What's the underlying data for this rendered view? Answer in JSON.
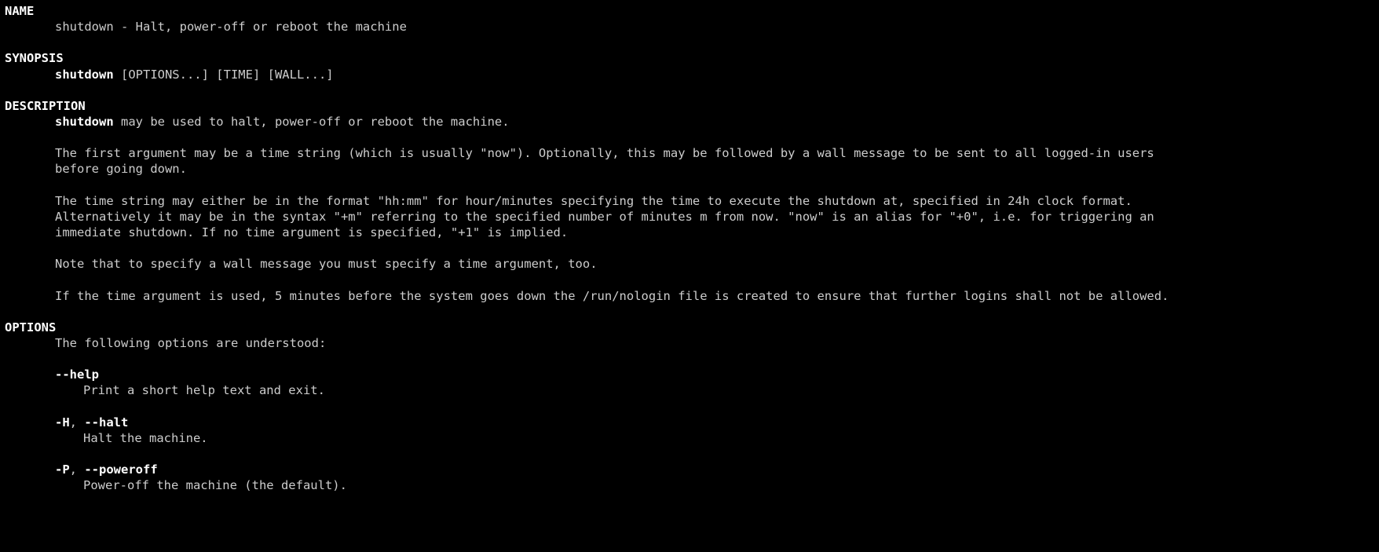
{
  "sections": {
    "name": {
      "header": "NAME",
      "line": "shutdown - Halt, power-off or reboot the machine"
    },
    "synopsis": {
      "header": "SYNOPSIS",
      "cmd": "shutdown",
      "args": " [OPTIONS...] [TIME] [WALL...]"
    },
    "description": {
      "header": "DESCRIPTION",
      "lead_cmd": "shutdown",
      "lead_rest": " may be used to halt, power-off or reboot the machine.",
      "p2a": "The first argument may be a time string (which is usually \"now\"). Optionally, this may be followed by a wall message to be sent to all logged-in users",
      "p2b": "before going down.",
      "p3a": "The time string may either be in the format \"hh:mm\" for hour/minutes specifying the time to execute the shutdown at, specified in 24h clock format.",
      "p3b": "Alternatively it may be in the syntax \"+m\" referring to the specified number of minutes m from now.  \"now\" is an alias for \"+0\", i.e. for triggering an",
      "p3c": "immediate shutdown. If no time argument is specified, \"+1\" is implied.",
      "p4": "Note that to specify a wall message you must specify a time argument, too.",
      "p5": "If the time argument is used, 5 minutes before the system goes down the /run/nologin file is created to ensure that further logins shall not be allowed."
    },
    "options": {
      "header": "OPTIONS",
      "intro": "The following options are understood:",
      "help": {
        "flag": "--help",
        "desc": "Print a short help text and exit."
      },
      "halt": {
        "short": "-H",
        "sep": ", ",
        "long": "--halt",
        "desc": "Halt the machine."
      },
      "poweroff": {
        "short": "-P",
        "sep": ", ",
        "long": "--poweroff",
        "desc": "Power-off the machine (the default)."
      }
    }
  }
}
